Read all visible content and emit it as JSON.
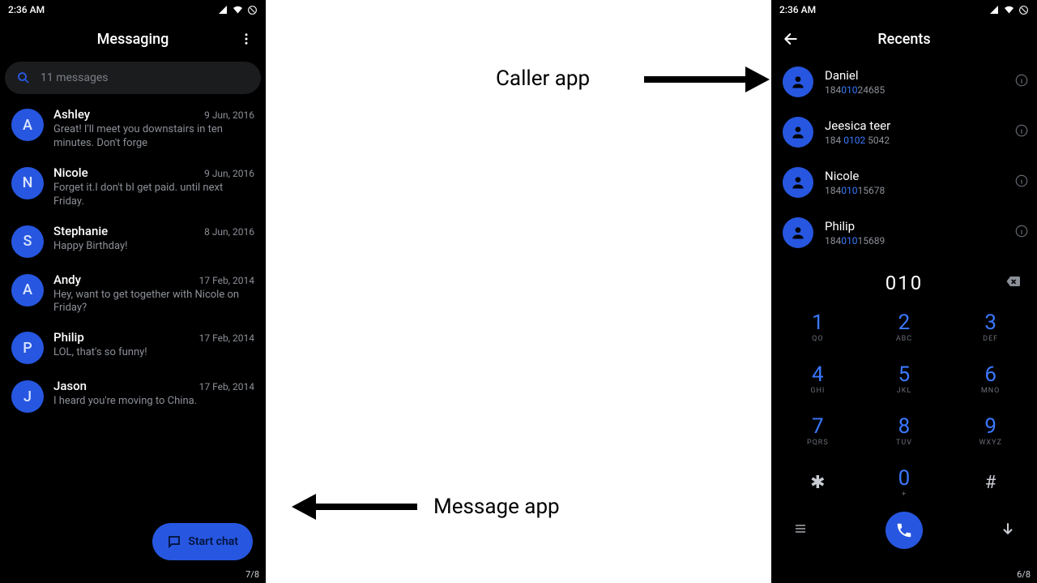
{
  "status": {
    "time": "2:36 AM"
  },
  "messaging": {
    "title": "Messaging",
    "search_placeholder": "11 messages",
    "fab_label": "Start chat",
    "page_indicator": "7/8",
    "threads": [
      {
        "initial": "A",
        "name": "Ashley",
        "date": "9 Jun, 2016",
        "preview": "Great! I'll meet you downstairs in ten minutes. Don't forge"
      },
      {
        "initial": "N",
        "name": "Nicole",
        "date": "9 Jun, 2016",
        "preview": "Forget it.I don't bI get paid. until next Friday."
      },
      {
        "initial": "S",
        "name": "Stephanie",
        "date": "8 Jun, 2016",
        "preview": "Happy Birthday!"
      },
      {
        "initial": "A",
        "name": "Andy",
        "date": "17 Feb, 2014",
        "preview": "Hey, want to get together with Nicole on Friday?"
      },
      {
        "initial": "P",
        "name": "Philip",
        "date": "17 Feb, 2014",
        "preview": "LOL, that's so funny!"
      },
      {
        "initial": "J",
        "name": "Jason",
        "date": "17 Feb, 2014",
        "preview": "I heard you're moving to China."
      }
    ]
  },
  "caller": {
    "title": "Recents",
    "dialed": "010",
    "page_indicator": "6/8",
    "contacts": [
      {
        "name": "Daniel",
        "number_pre": "184",
        "number_hl": "010",
        "number_post": "24685"
      },
      {
        "name": "Jeesica teer",
        "number_pre": "184 ",
        "number_hl": "0102",
        "number_post": " 5042"
      },
      {
        "name": "Nicole",
        "number_pre": "184",
        "number_hl": "010",
        "number_post": "15678"
      },
      {
        "name": "Philip",
        "number_pre": "184",
        "number_hl": "010",
        "number_post": "15689"
      }
    ],
    "keys": [
      {
        "digit": "1",
        "letters": "QO"
      },
      {
        "digit": "2",
        "letters": "ABC"
      },
      {
        "digit": "3",
        "letters": "DEF"
      },
      {
        "digit": "4",
        "letters": "GHI"
      },
      {
        "digit": "5",
        "letters": "JKL"
      },
      {
        "digit": "6",
        "letters": "MNO"
      },
      {
        "digit": "7",
        "letters": "PQRS"
      },
      {
        "digit": "8",
        "letters": "TUV"
      },
      {
        "digit": "9",
        "letters": "WXYZ"
      },
      {
        "digit": "✱",
        "letters": ""
      },
      {
        "digit": "0",
        "letters": "+"
      },
      {
        "digit": "#",
        "letters": ""
      }
    ]
  },
  "annotations": {
    "caller_label": "Caller app",
    "message_label": "Message app"
  }
}
